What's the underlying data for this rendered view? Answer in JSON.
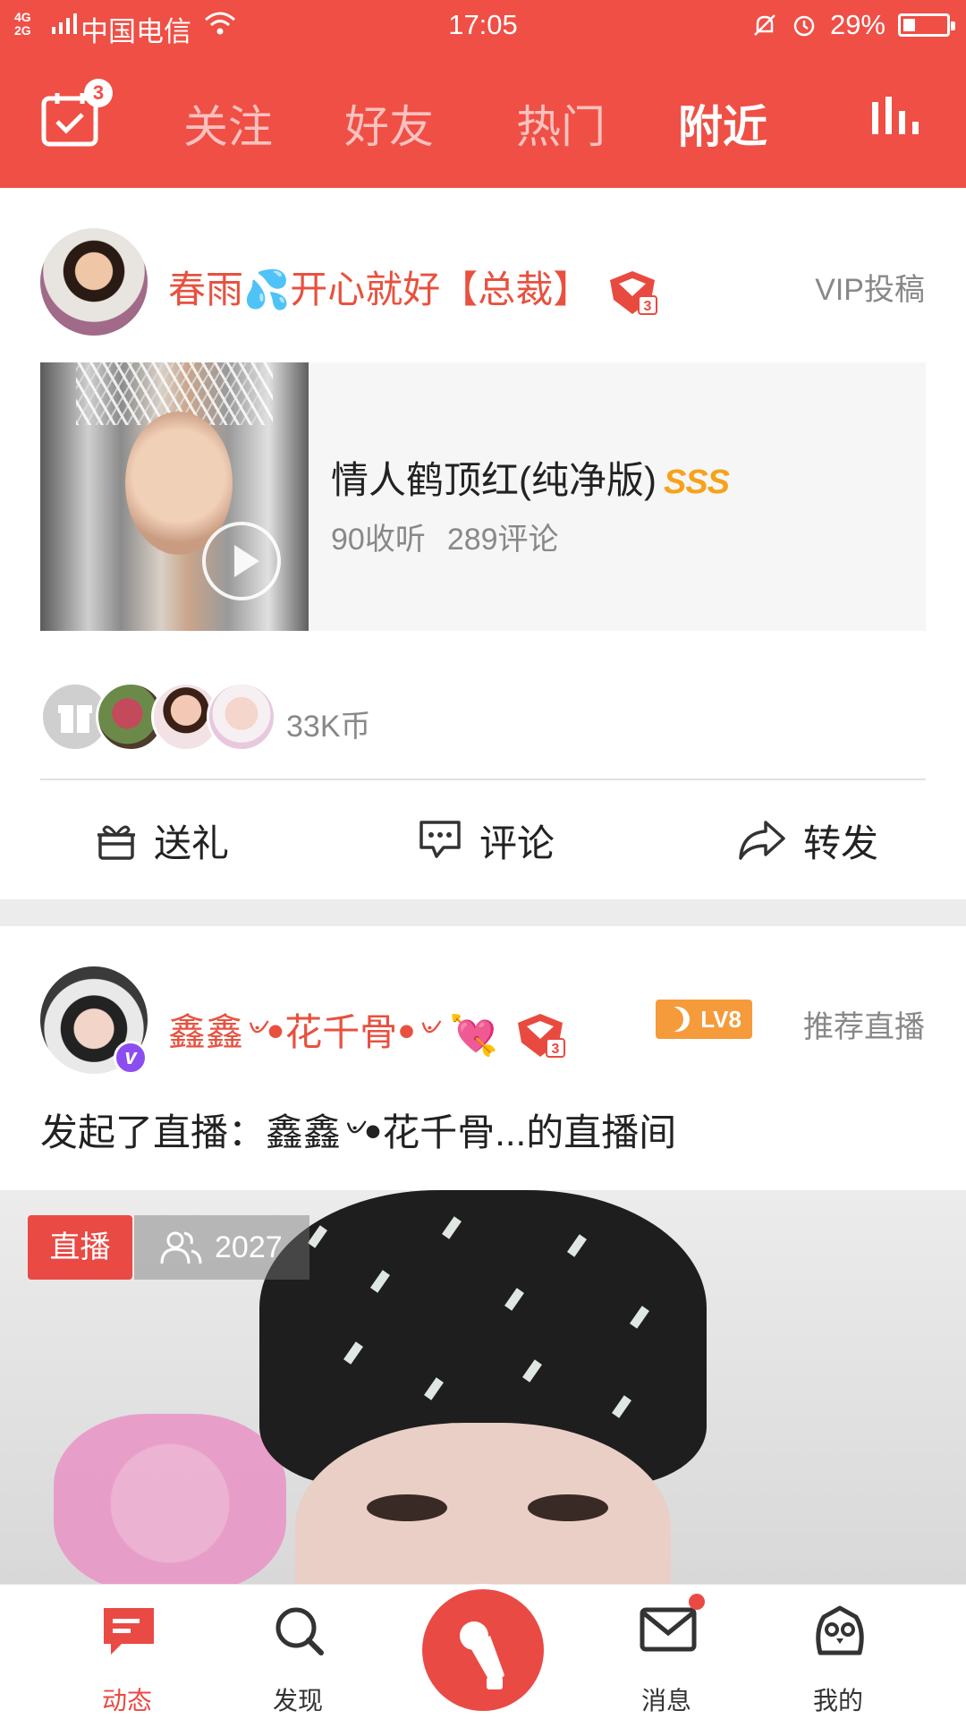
{
  "status_bar": {
    "network": "4G 2G",
    "carrier": "中国电信",
    "time": "17:05",
    "battery": "29%",
    "battery_level": 0.29
  },
  "top_tabs": {
    "calendar_badge": "3",
    "items": [
      {
        "label": "关注",
        "active": false
      },
      {
        "label": "好友",
        "active": false
      },
      {
        "label": "热门",
        "active": false
      },
      {
        "label": "附近",
        "active": true
      }
    ]
  },
  "post1": {
    "username": "春雨💦开心就好【总裁】",
    "tag": "VIP投稿",
    "song": {
      "title": "情人鹤顶红(纯净版)",
      "quality": "SSS",
      "listens": "90收听",
      "comments": "289评论"
    },
    "coins": "33K币",
    "actions": {
      "gift": "送礼",
      "comment": "评论",
      "share": "转发"
    }
  },
  "post2": {
    "username": "鑫鑫৺ꔷ花千骨ꔷ৺",
    "level_badge": "LV8",
    "tag": "推荐直播",
    "text": "发起了直播：鑫鑫৺ꔷ花千骨...的直播间",
    "live_badge": "直播",
    "viewers": "2027"
  },
  "bottom_nav": {
    "items": [
      {
        "label": "动态",
        "active": true
      },
      {
        "label": "发现",
        "active": false
      },
      {
        "label": "消息",
        "active": false
      },
      {
        "label": "我的",
        "active": false
      }
    ]
  },
  "colors": {
    "brand_red": "#ef4f45",
    "username_red": "#e8513f",
    "sss_orange": "#f7a21a",
    "vip_purple": "#8c4df0"
  }
}
